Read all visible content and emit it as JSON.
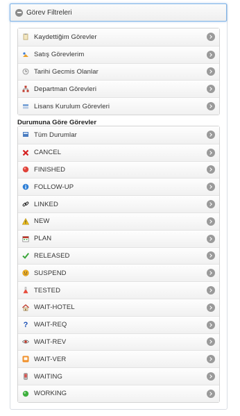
{
  "panel": {
    "title": "Görev Filtreleri"
  },
  "group1": {
    "items": [
      {
        "label": "Kaydettiğim Görevler",
        "icon": "clipboard-icon"
      },
      {
        "label": "Satış Görevlerim",
        "icon": "sales-icon"
      },
      {
        "label": "Tarihi Gecmis Olanlar",
        "icon": "clock-icon"
      },
      {
        "label": "Departman Görevleri",
        "icon": "org-chart-icon"
      },
      {
        "label": "Lisans Kurulum Görevleri",
        "icon": "install-icon"
      }
    ]
  },
  "group2": {
    "title": "Durumuna Göre Görevler",
    "items": [
      {
        "label": "Tüm Durumlar",
        "icon": "list-icon"
      },
      {
        "label": "CANCEL",
        "icon": "x-icon"
      },
      {
        "label": "FINISHED",
        "icon": "red-dot-icon"
      },
      {
        "label": "FOLLOW-UP",
        "icon": "info-icon"
      },
      {
        "label": "LINKED",
        "icon": "link-icon"
      },
      {
        "label": "NEW",
        "icon": "warning-icon"
      },
      {
        "label": "PLAN",
        "icon": "calendar-icon"
      },
      {
        "label": "RELEASED",
        "icon": "check-icon"
      },
      {
        "label": "SUSPEND",
        "icon": "smiley-icon"
      },
      {
        "label": "TESTED",
        "icon": "flask-icon"
      },
      {
        "label": "WAIT-HOTEL",
        "icon": "home-icon"
      },
      {
        "label": "WAIT-REQ",
        "icon": "question-icon"
      },
      {
        "label": "WAIT-REV",
        "icon": "eye-icon"
      },
      {
        "label": "WAIT-VER",
        "icon": "dialog-icon"
      },
      {
        "label": "WAITING",
        "icon": "phone-icon"
      },
      {
        "label": "WORKING",
        "icon": "green-dot-icon"
      }
    ]
  }
}
